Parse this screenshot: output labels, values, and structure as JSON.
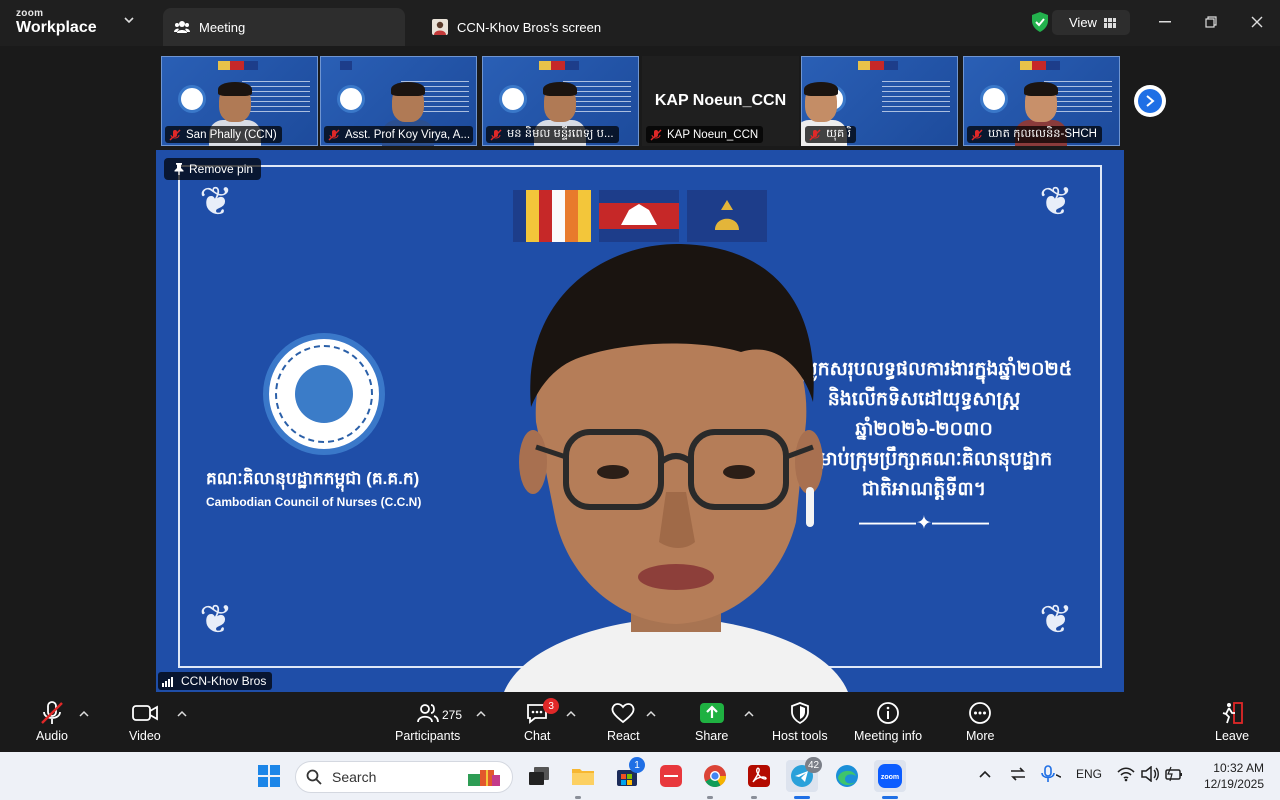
{
  "app": {
    "brand_top": "zoom",
    "brand_bottom": "Workplace",
    "tabs": [
      {
        "label": "Meeting"
      },
      {
        "label": "CCN-Khov Bros's screen"
      }
    ],
    "view_label": "View"
  },
  "participants_strip": [
    {
      "name": "San Phally (CCN)",
      "muted": true
    },
    {
      "name": "Asst. Prof Koy Virya, A...",
      "muted": true
    },
    {
      "name": "មន និមល មន្ទីរពេទ្យ ប...",
      "muted": true
    },
    {
      "name": "KAP Noeun_CCN",
      "display": "KAP Noeun_CCN",
      "muted": true
    },
    {
      "name": "យុគ រិ",
      "muted": true
    },
    {
      "name": "ឃាត កុលលេនិន-SHCH",
      "muted": true
    }
  ],
  "main_video": {
    "remove_pin_label": "Remove pin",
    "speaker_name": "CCN-Khov Bros",
    "slide": {
      "org_name_kh": "គណៈគិលានុបដ្ឋាកកម្ពុជា (គ.គ.ក)",
      "org_name_en": "Cambodian Council of Nurses (C.C.N)",
      "title_lines_kh": [
        "ប្រជុំបូកសរុបលទ្ធផលការងារក្នុងឆ្នាំ២០២៥",
        "និងលើកទិសដៅយុទ្ធសាស្ត្រ",
        "ឆ្នាំ២០២៦-២០៣០",
        "សម្រាប់ក្រុមប្រឹក្សាគណៈគិលានុបដ្ឋាក",
        "ជាតិអាណត្តិទី៣។"
      ]
    }
  },
  "toolbar": {
    "audio": "Audio",
    "video": "Video",
    "participants": "Participants",
    "participants_count": "275",
    "chat": "Chat",
    "chat_badge": "3",
    "react": "React",
    "share": "Share",
    "host_tools": "Host tools",
    "meeting_info": "Meeting info",
    "more": "More",
    "leave": "Leave"
  },
  "taskbar": {
    "search_placeholder": "Search",
    "store_badge": "1",
    "telegram_badge": "42",
    "language": "ENG",
    "time": "10:32 AM",
    "date": "12/19/2025"
  },
  "colors": {
    "zoom_blue": "#0b5cff",
    "mute_red": "#e02828",
    "share_green": "#1fb141",
    "slide_blue": "#1f4ea8"
  }
}
